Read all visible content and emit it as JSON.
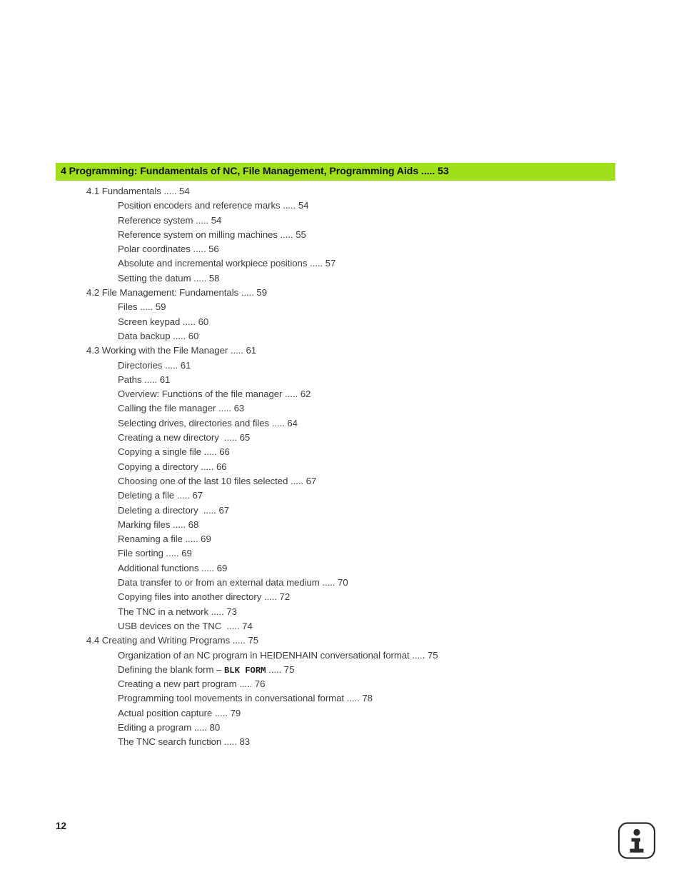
{
  "document": {
    "page_number": "12",
    "accent_color": "#9FE01B",
    "text_color": "#3b3b3b"
  },
  "chapter": {
    "title": "4 Programming: Fundamentals of NC, File Management, Programming Aids ..... 53"
  },
  "toc": {
    "entries": [
      {
        "level": 1,
        "text": "4.1 Fundamentals ..... 54"
      },
      {
        "level": 2,
        "text": "Position encoders and reference marks ..... 54"
      },
      {
        "level": 2,
        "text": "Reference system ..... 54"
      },
      {
        "level": 2,
        "text": "Reference system on milling machines ..... 55"
      },
      {
        "level": 2,
        "text": "Polar coordinates ..... 56"
      },
      {
        "level": 2,
        "text": "Absolute and incremental workpiece positions ..... 57"
      },
      {
        "level": 2,
        "text": "Setting the datum ..... 58"
      },
      {
        "level": 1,
        "text": "4.2 File Management: Fundamentals ..... 59"
      },
      {
        "level": 2,
        "text": "Files ..... 59"
      },
      {
        "level": 2,
        "text": "Screen keypad ..... 60"
      },
      {
        "level": 2,
        "text": "Data backup ..... 60"
      },
      {
        "level": 1,
        "text": "4.3 Working with the File Manager ..... 61"
      },
      {
        "level": 2,
        "text": "Directories ..... 61"
      },
      {
        "level": 2,
        "text": "Paths ..... 61"
      },
      {
        "level": 2,
        "text": "Overview: Functions of the file manager ..... 62"
      },
      {
        "level": 2,
        "text": "Calling the file manager ..... 63"
      },
      {
        "level": 2,
        "text": "Selecting drives, directories and files ..... 64"
      },
      {
        "level": 2,
        "text": "Creating a new directory  ..... 65"
      },
      {
        "level": 2,
        "text": "Copying a single file ..... 66"
      },
      {
        "level": 2,
        "text": "Copying a directory ..... 66"
      },
      {
        "level": 2,
        "text": "Choosing one of the last 10 files selected ..... 67"
      },
      {
        "level": 2,
        "text": "Deleting a file ..... 67"
      },
      {
        "level": 2,
        "text": "Deleting a directory  ..... 67"
      },
      {
        "level": 2,
        "text": "Marking files ..... 68"
      },
      {
        "level": 2,
        "text": "Renaming a file ..... 69"
      },
      {
        "level": 2,
        "text": "File sorting ..... 69"
      },
      {
        "level": 2,
        "text": "Additional functions ..... 69"
      },
      {
        "level": 2,
        "text": "Data transfer to or from an external data medium ..... 70"
      },
      {
        "level": 2,
        "text": "Copying files into another directory ..... 72"
      },
      {
        "level": 2,
        "text": "The TNC in a network ..... 73"
      },
      {
        "level": 2,
        "text": "USB devices on the TNC  ..... 74"
      },
      {
        "level": 1,
        "text": "4.4 Creating and Writing Programs ..... 75"
      },
      {
        "level": 2,
        "text": "Organization of an NC program in HEIDENHAIN conversational format ..... 75"
      },
      {
        "level": 2,
        "text": "Defining the blank form – ",
        "mono": "BLK FORM",
        "text_after": " ..... 75"
      },
      {
        "level": 2,
        "text": "Creating a new part program ..... 76"
      },
      {
        "level": 2,
        "text": "Programming tool movements in conversational format ..... 78"
      },
      {
        "level": 2,
        "text": "Actual position capture ..... 79"
      },
      {
        "level": 2,
        "text": "Editing a program ..... 80"
      },
      {
        "level": 2,
        "text": "The TNC search function ..... 83"
      }
    ]
  },
  "footer": {
    "info_icon_label": "information-icon",
    "info_icon_glyph": "i"
  }
}
